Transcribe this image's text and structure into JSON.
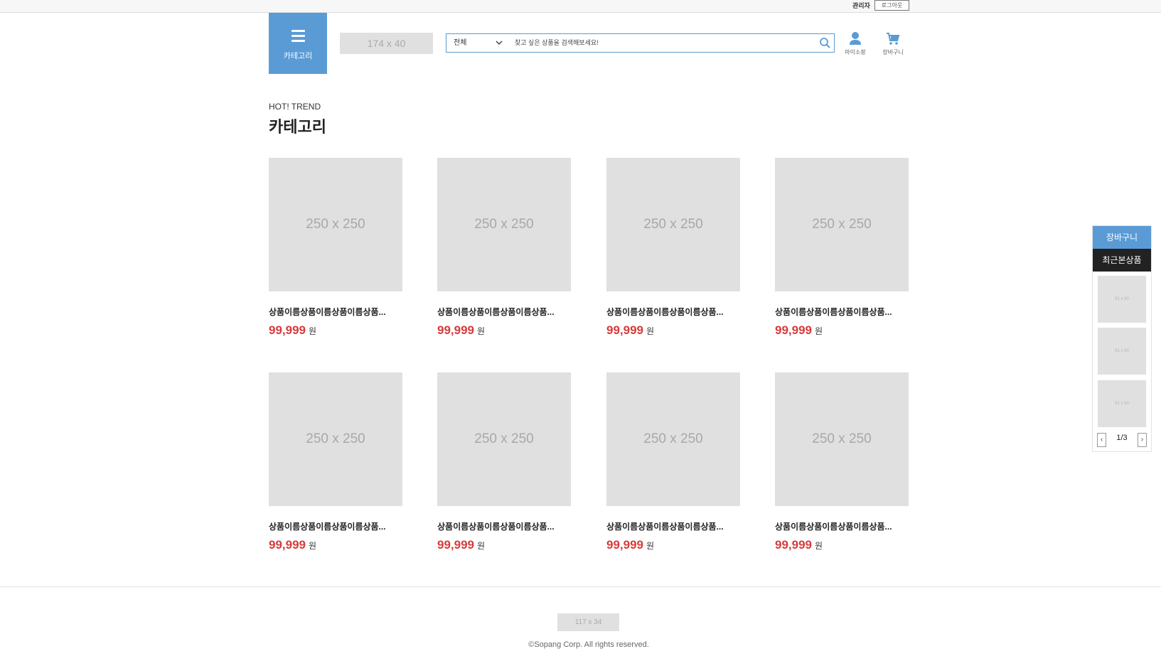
{
  "topbar": {
    "admin_label": "관리자",
    "login_label": "로그아웃"
  },
  "header": {
    "category_label": "카테고리",
    "logo_placeholder": "174 x 40",
    "search": {
      "select_value": "전체",
      "placeholder": "찾고 싶은 상품을 검색해보세요!"
    },
    "mypage_label": "마이소팡",
    "cart_label": "장바구니"
  },
  "section": {
    "eyebrow": "HOT! TREND",
    "title": "카테고리"
  },
  "products": [
    {
      "image": "250 x 250",
      "name": "상품이름상품이름상품이름상품...",
      "price": "99,999",
      "currency": "원"
    },
    {
      "image": "250 x 250",
      "name": "상품이름상품이름상품이름상품...",
      "price": "99,999",
      "currency": "원"
    },
    {
      "image": "250 x 250",
      "name": "상품이름상품이름상품이름상품...",
      "price": "99,999",
      "currency": "원"
    },
    {
      "image": "250 x 250",
      "name": "상품이름상품이름상품이름상품...",
      "price": "99,999",
      "currency": "원"
    },
    {
      "image": "250 x 250",
      "name": "상품이름상품이름상품이름상품...",
      "price": "99,999",
      "currency": "원"
    },
    {
      "image": "250 x 250",
      "name": "상품이름상품이름상품이름상품...",
      "price": "99,999",
      "currency": "원"
    },
    {
      "image": "250 x 250",
      "name": "상품이름상품이름상품이름상품...",
      "price": "99,999",
      "currency": "원"
    },
    {
      "image": "250 x 250",
      "name": "상품이름상품이름상품이름상품...",
      "price": "99,999",
      "currency": "원"
    }
  ],
  "sidebar": {
    "cart_tab": "장바구니",
    "recent_tab": "최근본상품",
    "thumbs": [
      "91 x 90",
      "91 x 90",
      "91 x 90"
    ],
    "prev_label": "‹",
    "next_label": "›",
    "page": "1/3"
  },
  "footer": {
    "logo_placeholder": "117 x 34",
    "copyright": "©Sopang Corp. All rights reserved."
  },
  "colors": {
    "accent": "#5a9bd5",
    "price": "#d83a3a",
    "dark_tab": "#222222",
    "placeholder_bg": "#e0e0e0"
  },
  "icons": [
    "menu-icon",
    "chevron-down-icon",
    "search-icon",
    "user-icon",
    "cart-icon",
    "chevron-left-icon",
    "chevron-right-icon"
  ]
}
